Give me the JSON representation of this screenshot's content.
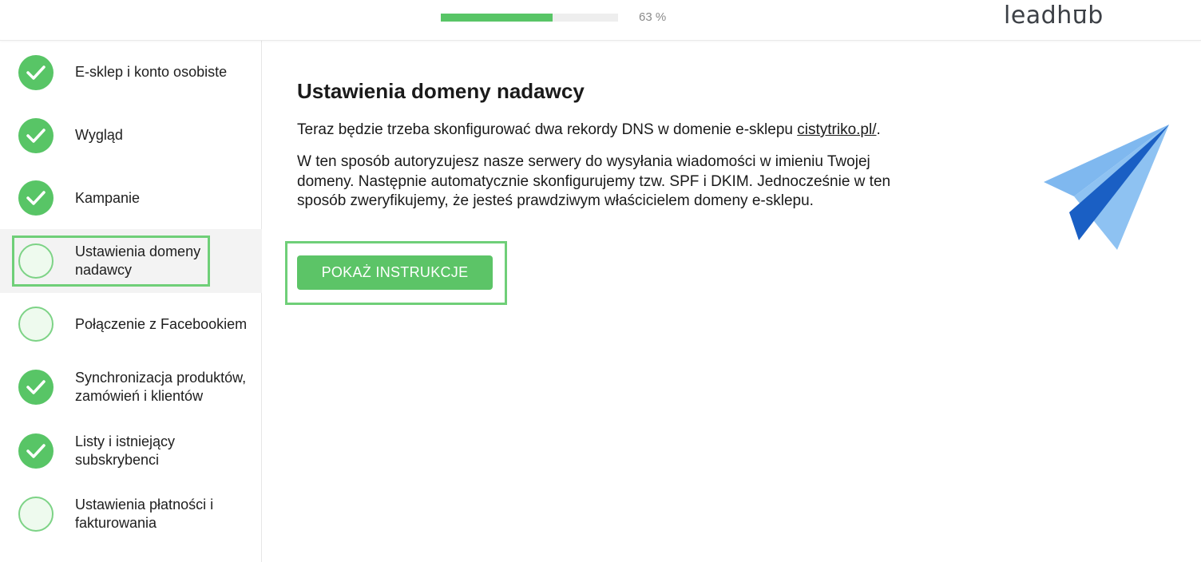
{
  "progress": {
    "value": 0.63,
    "label": "63 %"
  },
  "logo": {
    "pre": "leadh",
    "u": "u",
    "post": "b"
  },
  "sidebar": {
    "steps": [
      {
        "label": "E-sklep i konto osobiste",
        "status": "done"
      },
      {
        "label": "Wygląd",
        "status": "done"
      },
      {
        "label": "Kampanie",
        "status": "done"
      },
      {
        "label": "Ustawienia domeny nadawcy",
        "status": "current"
      },
      {
        "label": "Połączenie z Facebookiem",
        "status": "todo"
      },
      {
        "label": "Synchronizacja produktów, zamówień i klientów",
        "status": "done"
      },
      {
        "label": "Listy i istniejący subskrybenci",
        "status": "done"
      },
      {
        "label": "Ustawienia płatności i fakturowania",
        "status": "todo"
      }
    ]
  },
  "main": {
    "title": "Ustawienia domeny nadawcy",
    "intro_text": "Teraz będzie trzeba skonfigurować dwa rekordy DNS w domenie e-sklepu ",
    "domain_link": "cistytriko.pl/",
    "intro_end": ".",
    "description": "W ten sposób autoryzujesz nasze serwery do wysyłania wiadomości w imieniu Twojej domeny. Następnie automatycznie skonfigurujemy tzw. SPF i DKIM. Jednocześnie w ten sposób zweryfikujemy, że jesteś prawdziwym właścicielem domeny e-sklepu.",
    "button_label": "POKAŻ INSTRUKCJE"
  },
  "icons": {
    "done": "check-icon",
    "illustration": "paper-plane-icon"
  },
  "colors": {
    "accent": "#58c566",
    "plane_light": "#7fb8ef",
    "plane_dark": "#1a5fc4"
  }
}
